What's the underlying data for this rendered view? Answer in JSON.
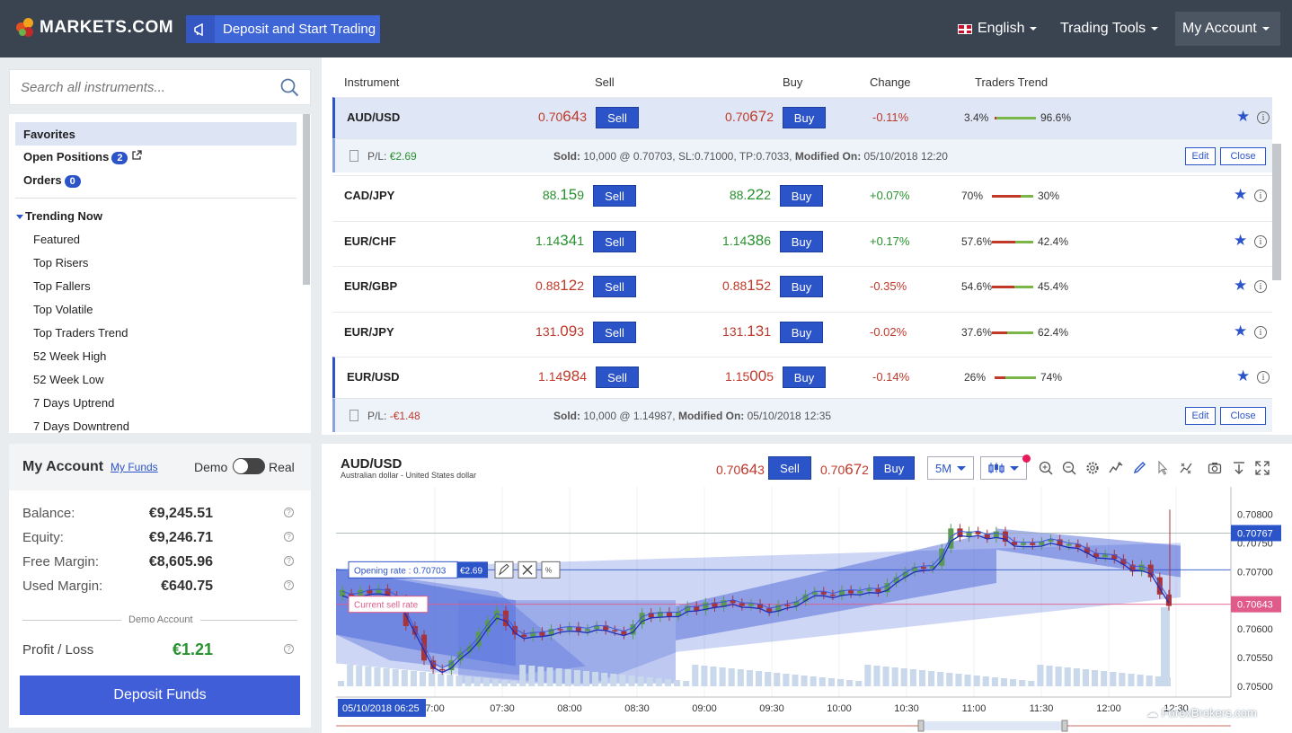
{
  "brand": {
    "name": "MARKETS.COM"
  },
  "header": {
    "deposit_cta": "Deposit and Start Trading",
    "language": "English",
    "trading_tools": "Trading Tools",
    "my_account": "My Account"
  },
  "search": {
    "placeholder": "Search all instruments..."
  },
  "sidebar": {
    "favorites": "Favorites",
    "open_positions": "Open Positions",
    "open_positions_count": "2",
    "orders": "Orders",
    "orders_count": "0",
    "trending_now": "Trending Now",
    "items": [
      "Featured",
      "Top Risers",
      "Top Fallers",
      "Top Volatile",
      "Top Traders Trend",
      "52 Week High",
      "52 Week Low",
      "7 Days Uptrend",
      "7 Days Downtrend"
    ]
  },
  "account": {
    "title": "My Account",
    "my_funds": "My Funds",
    "demo": "Demo",
    "real": "Real",
    "fields": [
      {
        "label": "Balance:",
        "value": "€9,245.51"
      },
      {
        "label": "Equity:",
        "value": "€9,246.71"
      },
      {
        "label": "Free Margin:",
        "value": "€8,605.96"
      },
      {
        "label": "Used Margin:",
        "value": "€640.75"
      }
    ],
    "demo_account": "Demo Account",
    "profit_loss_label": "Profit / Loss",
    "profit_loss_value": "€1.21",
    "deposit_button": "Deposit Funds"
  },
  "table": {
    "headers": {
      "instrument": "Instrument",
      "sell": "Sell",
      "buy": "Buy",
      "change": "Change",
      "traders_trend": "Traders Trend"
    },
    "sell_label": "Sell",
    "buy_label": "Buy",
    "rows": [
      {
        "symbol": "AUD/USD",
        "sell_a": "0.70",
        "sell_b": "64",
        "sell_c": "3",
        "buy_a": "0.70",
        "buy_b": "67",
        "buy_c": "2",
        "change": "-0.11%",
        "trend_left": "3.4%",
        "trend_right": "96.6%",
        "sell_share": 0.034
      },
      {
        "symbol": "CAD/JPY",
        "sell_a": "88.",
        "sell_b": "15",
        "sell_c": "9",
        "buy_a": "88.",
        "buy_b": "22",
        "buy_c": "2",
        "change": "+0.07%",
        "trend_left": "70%",
        "trend_right": "30%",
        "sell_share": 0.7
      },
      {
        "symbol": "EUR/CHF",
        "sell_a": "1.14",
        "sell_b": "34",
        "sell_c": "1",
        "buy_a": "1.14",
        "buy_b": "38",
        "buy_c": "6",
        "change": "+0.17%",
        "trend_left": "57.6%",
        "trend_right": "42.4%",
        "sell_share": 0.576
      },
      {
        "symbol": "EUR/GBP",
        "sell_a": "0.88",
        "sell_b": "12",
        "sell_c": "2",
        "buy_a": "0.88",
        "buy_b": "15",
        "buy_c": "2",
        "change": "-0.35%",
        "trend_left": "54.6%",
        "trend_right": "45.4%",
        "sell_share": 0.546
      },
      {
        "symbol": "EUR/JPY",
        "sell_a": "131.",
        "sell_b": "09",
        "sell_c": "3",
        "buy_a": "131.",
        "buy_b": "13",
        "buy_c": "1",
        "change": "-0.02%",
        "trend_left": "37.6%",
        "trend_right": "62.4%",
        "sell_share": 0.376
      },
      {
        "symbol": "EUR/USD",
        "sell_a": "1.14",
        "sell_b": "98",
        "sell_c": "4",
        "buy_a": "1.15",
        "buy_b": "00",
        "buy_c": "5",
        "change": "-0.14%",
        "trend_left": "26%",
        "trend_right": "74%",
        "sell_share": 0.26
      }
    ],
    "positions": [
      {
        "pl_label": "P/L:",
        "pl_value": "€2.69",
        "sold_label": "Sold:",
        "sold_value": "10,000 @ 0.70703,",
        "sl": "SL:0.71000,",
        "tp": "TP:0.7033,",
        "modified_label": "Modified On:",
        "modified_value": "05/10/2018 12:20",
        "edit": "Edit",
        "close": "Close"
      },
      {
        "pl_label": "P/L:",
        "pl_value": "-€1.48",
        "sold_label": "Sold:",
        "sold_value": "10,000 @ 1.14987,",
        "modified_label": "Modified On:",
        "modified_value": "05/10/2018 12:35",
        "edit": "Edit",
        "close": "Close"
      }
    ]
  },
  "chart_panel": {
    "symbol": "AUD/USD",
    "subtitle": "Australian dollar - United States dollar",
    "sell_a": "0.70",
    "sell_b": "64",
    "sell_c": "3",
    "buy_a": "0.70",
    "buy_b": "67",
    "buy_c": "2",
    "sell_label": "Sell",
    "buy_label": "Buy",
    "timeframe": "5M",
    "opening_rate_label": "Opening rate : 0.70703",
    "opening_pl": "€2.69",
    "current_sell_label": "Current sell rate",
    "date_tag": "05/10/2018 06:25",
    "last_price_tag": "0.70767",
    "current_price_tag": "0.70643"
  },
  "chart_data": {
    "type": "candlestick",
    "y_ticks": [
      "0.70800",
      "0.70750",
      "0.70700",
      "0.70650",
      "0.70600",
      "0.70550",
      "0.70500"
    ],
    "x_ticks": [
      "7:00",
      "07:30",
      "08:00",
      "08:30",
      "09:00",
      "09:30",
      "10:00",
      "10:30",
      "11:00",
      "11:30",
      "12:00",
      "12:30"
    ],
    "ylim": [
      0.705,
      0.7081
    ],
    "candles": [
      [
        0.70657,
        0.70668
      ],
      [
        0.70662,
        0.70652
      ],
      [
        0.70652,
        0.70668
      ],
      [
        0.70668,
        0.70662
      ],
      [
        0.70662,
        0.7067
      ],
      [
        0.7067,
        0.70658
      ],
      [
        0.70658,
        0.70652
      ],
      [
        0.70652,
        0.70605
      ],
      [
        0.70605,
        0.7059
      ],
      [
        0.7059,
        0.70545
      ],
      [
        0.70545,
        0.7053
      ],
      [
        0.7053,
        0.70528
      ],
      [
        0.70528,
        0.70545
      ],
      [
        0.70545,
        0.7056
      ],
      [
        0.7056,
        0.7057
      ],
      [
        0.7057,
        0.70595
      ],
      [
        0.70595,
        0.70615
      ],
      [
        0.70615,
        0.70632
      ],
      [
        0.70632,
        0.70605
      ],
      [
        0.70605,
        0.7059
      ],
      [
        0.7059,
        0.70586
      ],
      [
        0.70586,
        0.70595
      ],
      [
        0.70595,
        0.70588
      ],
      [
        0.70588,
        0.706
      ],
      [
        0.706,
        0.70598
      ],
      [
        0.70598,
        0.70604
      ],
      [
        0.70604,
        0.70596
      ],
      [
        0.70596,
        0.706
      ],
      [
        0.706,
        0.70606
      ],
      [
        0.70606,
        0.70598
      ],
      [
        0.70598,
        0.70596
      ],
      [
        0.70596,
        0.7059
      ],
      [
        0.7059,
        0.70608
      ],
      [
        0.70608,
        0.70628
      ],
      [
        0.70628,
        0.7062
      ],
      [
        0.7062,
        0.7063
      ],
      [
        0.7063,
        0.70622
      ],
      [
        0.70622,
        0.7063
      ],
      [
        0.7063,
        0.7064
      ],
      [
        0.7064,
        0.70632
      ],
      [
        0.70632,
        0.70646
      ],
      [
        0.70646,
        0.70638
      ],
      [
        0.70638,
        0.7065
      ],
      [
        0.7065,
        0.70645
      ],
      [
        0.70645,
        0.7064
      ],
      [
        0.7064,
        0.70644
      ],
      [
        0.70644,
        0.70636
      ],
      [
        0.70636,
        0.7063
      ],
      [
        0.7063,
        0.70642
      ],
      [
        0.70642,
        0.7064
      ],
      [
        0.7064,
        0.70648
      ],
      [
        0.70648,
        0.7066
      ],
      [
        0.7066,
        0.70665
      ],
      [
        0.70665,
        0.7066
      ],
      [
        0.7066,
        0.70658
      ],
      [
        0.70658,
        0.70668
      ],
      [
        0.70668,
        0.70662
      ],
      [
        0.70662,
        0.70666
      ],
      [
        0.70666,
        0.7067
      ],
      [
        0.7067,
        0.70664
      ],
      [
        0.70664,
        0.7068
      ],
      [
        0.7068,
        0.7069
      ],
      [
        0.7069,
        0.707
      ],
      [
        0.707,
        0.70708
      ],
      [
        0.70708,
        0.70705
      ],
      [
        0.70705,
        0.7071
      ],
      [
        0.7071,
        0.7074
      ],
      [
        0.7074,
        0.70775
      ],
      [
        0.70775,
        0.7076
      ],
      [
        0.7076,
        0.7077
      ],
      [
        0.7077,
        0.70765
      ],
      [
        0.70765,
        0.70758
      ],
      [
        0.70758,
        0.7077
      ],
      [
        0.7077,
        0.70752
      ],
      [
        0.70752,
        0.70746
      ],
      [
        0.70746,
        0.7075
      ],
      [
        0.7075,
        0.70746
      ],
      [
        0.70746,
        0.70752
      ],
      [
        0.70752,
        0.70756
      ],
      [
        0.70756,
        0.70745
      ],
      [
        0.70745,
        0.70748
      ],
      [
        0.70748,
        0.70742
      ],
      [
        0.70742,
        0.70732
      ],
      [
        0.70732,
        0.70725
      ],
      [
        0.70725,
        0.7073
      ],
      [
        0.7073,
        0.70722
      ],
      [
        0.70722,
        0.70712
      ],
      [
        0.70712,
        0.707
      ],
      [
        0.707,
        0.70712
      ],
      [
        0.70712,
        0.7069
      ],
      [
        0.7069,
        0.7066
      ],
      [
        0.7066,
        0.7064
      ]
    ]
  }
}
